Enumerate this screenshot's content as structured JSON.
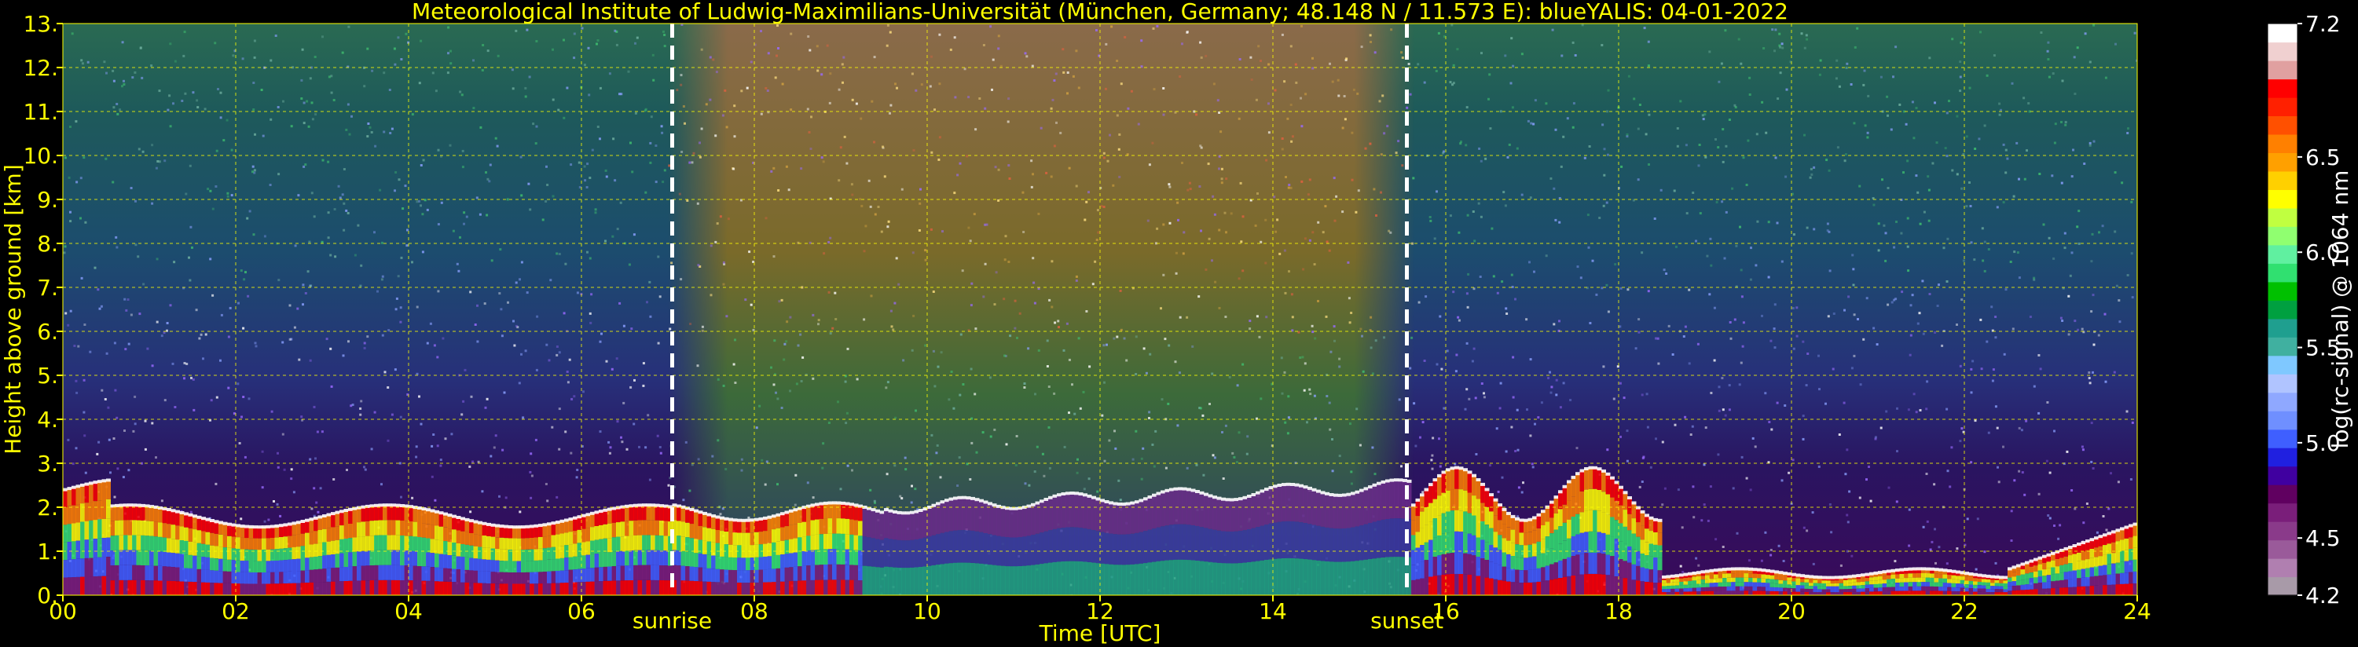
{
  "chart_data": {
    "type": "heatmap",
    "title": "Meteorological Institute of Ludwig-Maximilians-Universität (München, Germany; 48.148 N / 11.573 E):     blueYALIS: 04-01-2022",
    "xlabel": "Time [UTC]",
    "ylabel": "Height above ground [km]",
    "xlim": [
      0,
      24
    ],
    "ylim": [
      0,
      13
    ],
    "x_ticks": [
      0,
      2,
      4,
      6,
      8,
      10,
      12,
      14,
      16,
      18,
      20,
      22,
      24
    ],
    "x_tick_labels": [
      "00",
      "02",
      "04",
      "06",
      "08",
      "10",
      "12",
      "14",
      "16",
      "18",
      "20",
      "22",
      "24"
    ],
    "y_ticks": [
      0,
      1,
      2,
      3,
      4,
      5,
      6,
      7,
      8,
      9,
      10,
      11,
      12,
      13
    ],
    "y_tick_labels": [
      "0.",
      "1.",
      "2.",
      "3.",
      "4.",
      "5.",
      "6.",
      "7.",
      "8.",
      "9.",
      "10.",
      "11.",
      "12.",
      "13."
    ],
    "grid": true,
    "grid_color": "#ffff00",
    "markers": [
      {
        "label": "sunrise",
        "x": 7.05
      },
      {
        "label": "sunset",
        "x": 15.55
      }
    ],
    "colorbar": {
      "label": "log(rc-signal) @ 1064 nm",
      "min": 4.2,
      "max": 7.2,
      "tick_values": [
        4.2,
        4.5,
        5.0,
        5.5,
        6.0,
        6.5,
        7.2
      ],
      "tick_labels": [
        "4.2",
        "4.5",
        "5.0",
        "5.5",
        "6.0",
        "6.5",
        "7.2"
      ],
      "colors": [
        "#a89aa8",
        "#b07fb0",
        "#9a5a9a",
        "#8a3a8a",
        "#7a1e7a",
        "#600060",
        "#4000a0",
        "#2020e0",
        "#3f5fff",
        "#6f8fff",
        "#8fa8ff",
        "#b0c4ff",
        "#7fc8ff",
        "#40b0a0",
        "#1f9f8f",
        "#00a040",
        "#00c000",
        "#30e070",
        "#60f0a0",
        "#90ff70",
        "#c0ff40",
        "#ffff00",
        "#ffd000",
        "#ffa000",
        "#ff8000",
        "#ff5000",
        "#ff2000",
        "#ff0000",
        "#e0a0a0",
        "#f0d0d0",
        "#ffffff"
      ]
    }
  }
}
